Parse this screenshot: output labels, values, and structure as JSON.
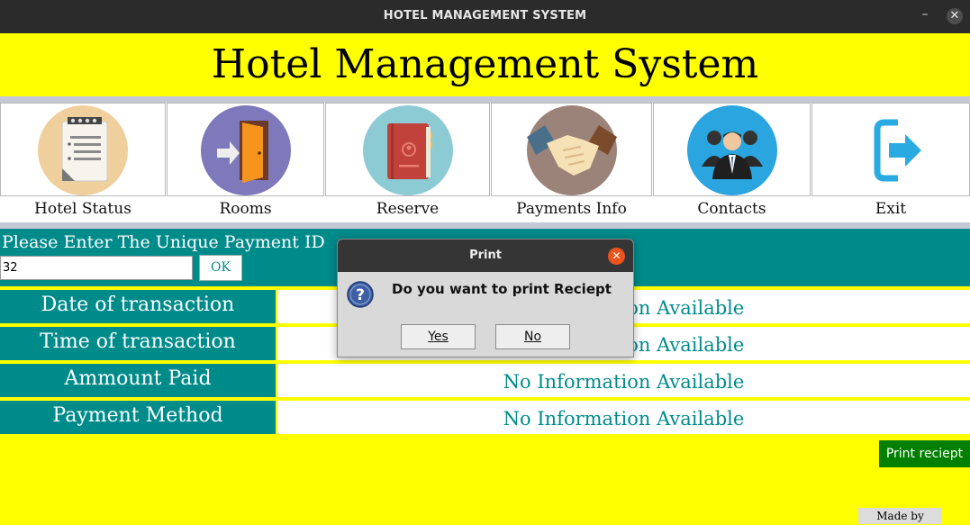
{
  "window": {
    "title": "HOTEL MANAGEMENT SYSTEM",
    "minimize_glyph": "–",
    "close_glyph": "✕"
  },
  "header": {
    "title": "Hotel Management System"
  },
  "nav": [
    {
      "label": "Hotel Status",
      "icon": "clipboard-icon",
      "circle_color": "#efcf9c"
    },
    {
      "label": "Rooms",
      "icon": "door-enter-icon",
      "circle_color": "#7e79bb"
    },
    {
      "label": "Reserve",
      "icon": "address-book-icon",
      "circle_color": "#8ccad4"
    },
    {
      "label": "Payments Info",
      "icon": "handshake-icon",
      "circle_color": "#9b837a"
    },
    {
      "label": "Contacts",
      "icon": "people-group-icon",
      "circle_color": "#2aa5df"
    },
    {
      "label": "Exit",
      "icon": "exit-arrow-icon",
      "circle_color": "#ffffff"
    }
  ],
  "payment": {
    "prompt": "Please Enter The Unique Payment ID",
    "id_value": "32",
    "ok_label": "OK",
    "rows": [
      {
        "label": "Date of transaction",
        "value": "No Information Available"
      },
      {
        "label": "Time of transaction",
        "value": "No Information Available"
      },
      {
        "label": "Ammount Paid",
        "value": "No Information Available"
      },
      {
        "label": "Payment Method",
        "value": "No Information Available"
      }
    ],
    "print_button": "Print reciept"
  },
  "credit": "Made by Manish",
  "dialog": {
    "title": "Print",
    "message": "Do you want to print Reciept",
    "yes_label": "Yes",
    "no_label": "No",
    "close_glyph": "✕"
  },
  "colors": {
    "background": "#ffff00",
    "teal": "#008b8b",
    "print_button": "#007f00",
    "dialog_close": "#e9541c"
  }
}
